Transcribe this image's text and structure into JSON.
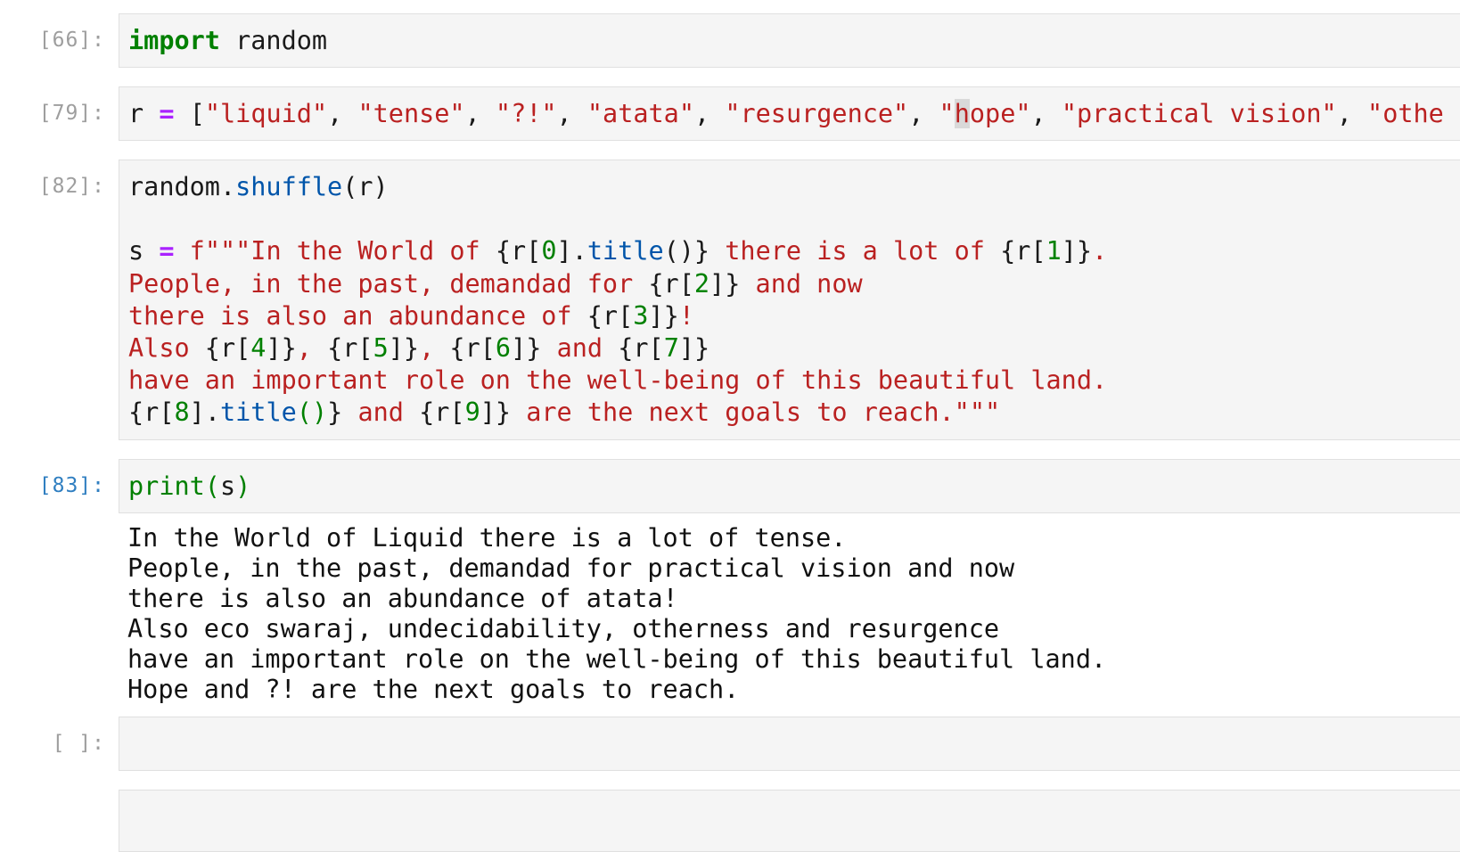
{
  "cells": {
    "c66": {
      "prompt": "[66]:",
      "kw_import": "import",
      "module": " random"
    },
    "c79": {
      "prompt": "[79]:",
      "var": "r",
      "eq": "=",
      "open": "[",
      "s1": "\"liquid\"",
      "s2": "\"tense\"",
      "s3": "\"?!\"",
      "s4": "\"atata\"",
      "s5": "\"resurgence\"",
      "s6a": "\"",
      "s6b": "h",
      "s6c": "ope\"",
      "s7": "\"practical vision\"",
      "s8": "\"othe",
      "sep": ", "
    },
    "c82": {
      "prompt": "[82]:",
      "l1_obj": "random.",
      "l1_fn": "shuffle",
      "l1_args": "(r)",
      "l3_var": "s ",
      "l3_eq": "=",
      "l3_str": " f\"\"\"In the World of ",
      "l3_open0": "{r[",
      "l3_idx0": "0",
      "l3_dot": "].",
      "l3_title": "title",
      "l3_paren0": "()}",
      "l3_mid": " there is a lot of ",
      "l3_open1": "{r[",
      "l3_idx1": "1",
      "l3_close1": "]}",
      "l3_end": ".",
      "l4_str": "People, in the past, demandad for ",
      "l4_open": "{r[",
      "l4_idx": "2",
      "l4_close": "]}",
      "l4_end": " and now",
      "l5_str": "there is also an abundance of ",
      "l5_open": "{r[",
      "l5_idx": "3",
      "l5_close": "]}",
      "l5_end": "!",
      "l6_str": "Also ",
      "l6_o4": "{r[",
      "l6_i4": "4",
      "l6_c4": "]}",
      "l6_s1": ", ",
      "l6_o5": "{r[",
      "l6_i5": "5",
      "l6_c5": "]}",
      "l6_s2": ", ",
      "l6_o6": "{r[",
      "l6_i6": "6",
      "l6_c6": "]}",
      "l6_s3": " and ",
      "l6_o7": "{r[",
      "l6_i7": "7",
      "l6_c7": "]}",
      "l7_str": "have an important role on the well-being of this beautiful land.",
      "l8_o8": "{r[",
      "l8_i8": "8",
      "l8_dot": "].",
      "l8_title": "title",
      "l8_paren": "()",
      "l8_c8": "}",
      "l8_and": " and ",
      "l8_o9": "{r[",
      "l8_i9": "9",
      "l8_c9": "]}",
      "l8_end": " are the next goals to reach.\"\"\""
    },
    "c83": {
      "prompt": "[83]:",
      "fn": "print",
      "p_open": "(",
      "arg": "s",
      "p_close": ")",
      "output": [
        "In the World of Liquid there is a lot of tense.",
        "People, in the past, demandad for practical vision and now",
        "there is also an abundance of atata!",
        "Also eco swaraj, undecidability, otherness and resurgence",
        "have an important role on the well-being of this beautiful land.",
        "Hope and ?! are the next goals to reach."
      ]
    },
    "empty": {
      "prompt": "[ ]:"
    }
  }
}
